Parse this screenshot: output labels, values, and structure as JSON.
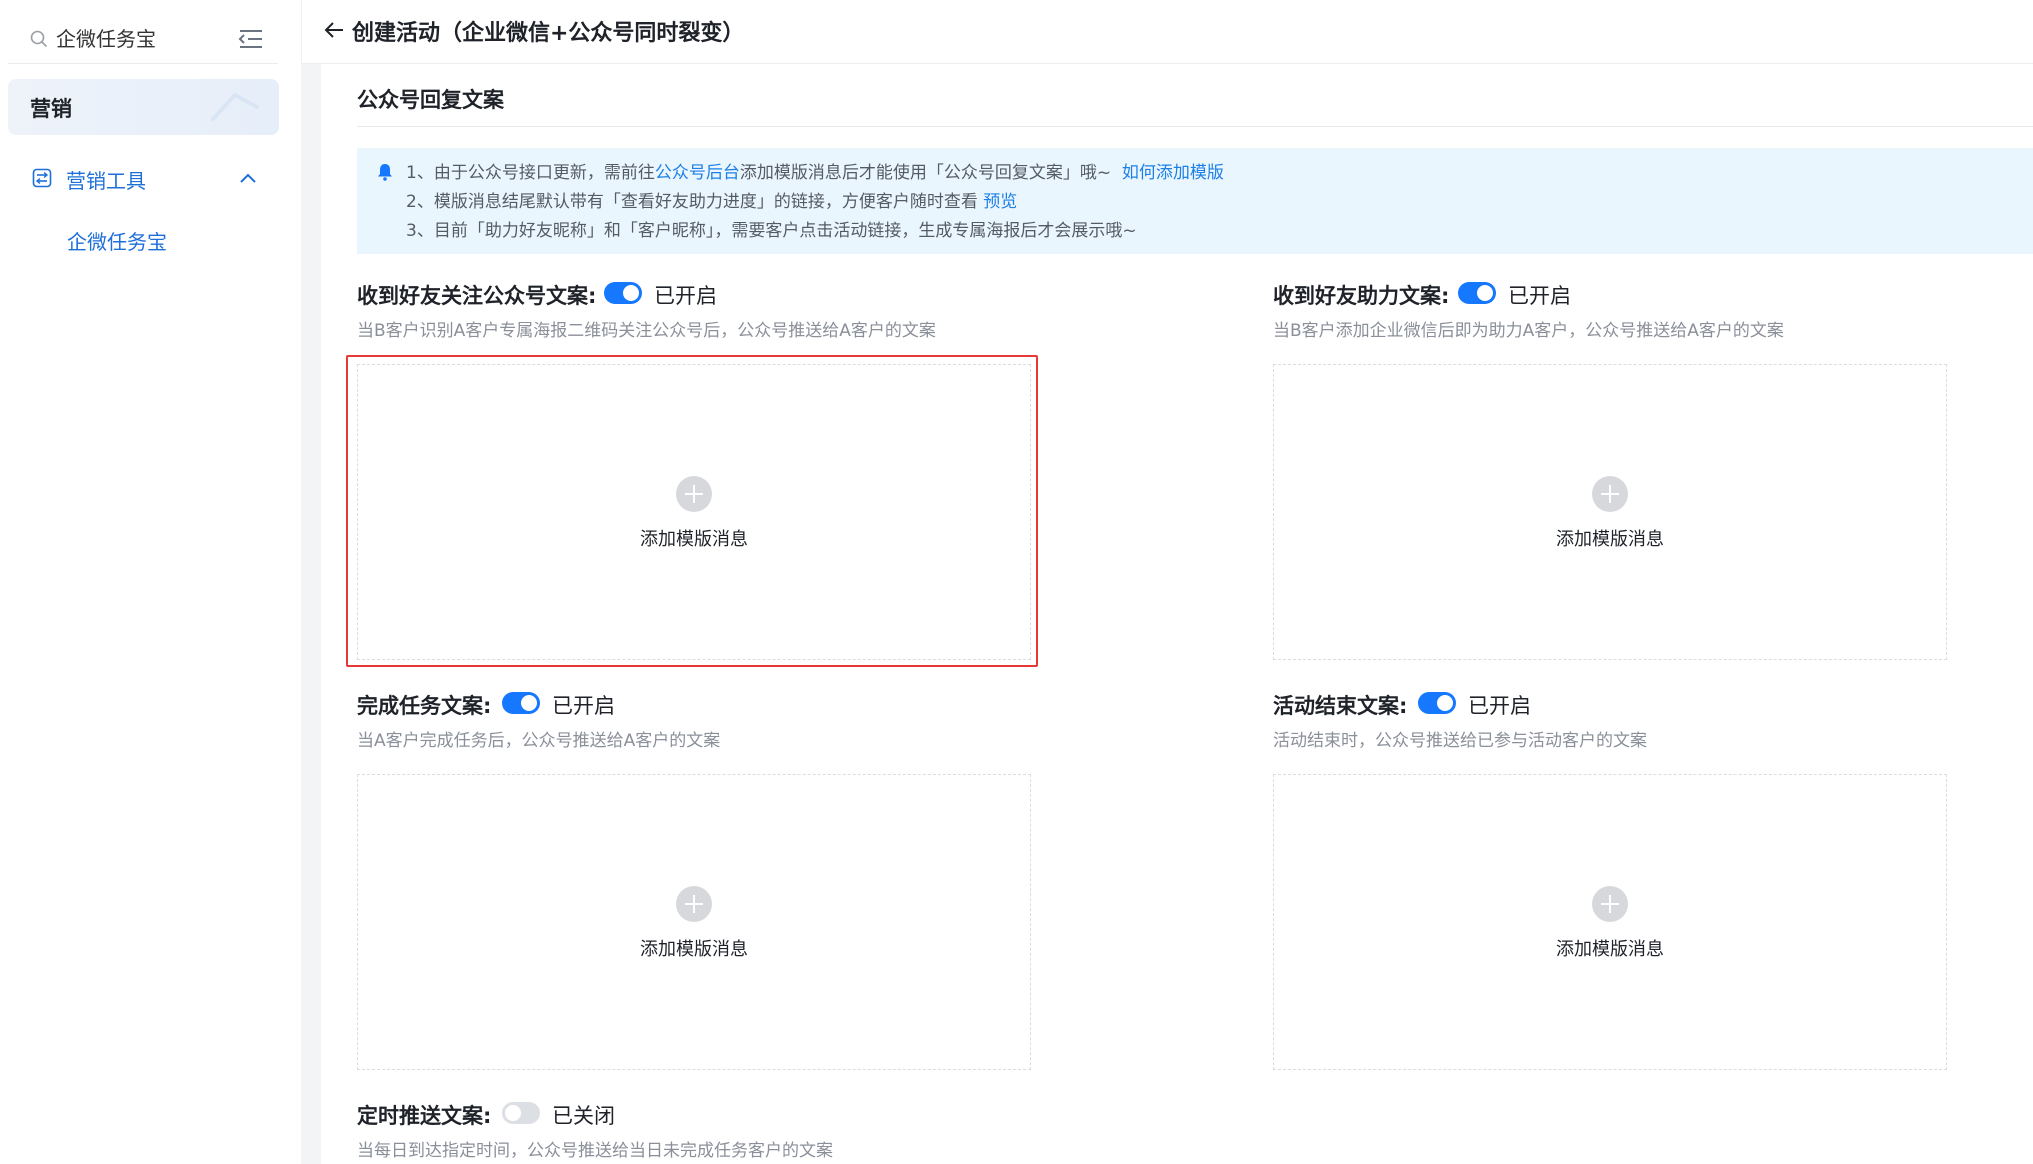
{
  "colors": {
    "accent": "#1677ff",
    "link": "#1e7fe6",
    "highlight": "#e53935",
    "notice_bg": "#eaf6fd"
  },
  "sidebar": {
    "search": {
      "placeholder": "企微任务宝",
      "icon": "search-icon"
    },
    "collapse_icon": "menu-collapse-icon",
    "active_item": "营销",
    "group": {
      "label": "营销工具",
      "icon": "tools-icon",
      "expanded": true
    },
    "sub_item": "企微任务宝"
  },
  "header": {
    "back_icon": "arrow-left-icon",
    "title": "创建活动（企业微信+公众号同时裂变）"
  },
  "section": {
    "title": "公众号回复文案"
  },
  "notice": {
    "icon": "bell-icon",
    "line1_a": "1、由于公众号接口更新，需前往",
    "line1_link": "公众号后台",
    "line1_b": "添加模版消息后才能使用「公众号回复文案」哦~",
    "line1_link2": "如何添加模版",
    "line2_a": "2、模版消息结尾默认带有「查看好友助力进度」的链接，方便客户随时查看",
    "line2_link": "预览",
    "line3": "3、目前「助力好友昵称」和「客户昵称」，需要客户点击活动链接，生成专属海报后才会展示哦~"
  },
  "blocks": [
    {
      "title": "收到好友关注公众号文案:",
      "enabled": true,
      "status": "已开启",
      "desc": "当B客户识别A客户专属海报二维码关注公众号后，公众号推送给A客户的文案",
      "upload_label": "添加模版消息",
      "highlighted": true
    },
    {
      "title": "收到好友助力文案:",
      "enabled": true,
      "status": "已开启",
      "desc": "当B客户添加企业微信后即为助力A客户，公众号推送给A客户的文案",
      "upload_label": "添加模版消息",
      "highlighted": false
    },
    {
      "title": "完成任务文案:",
      "enabled": true,
      "status": "已开启",
      "desc": "当A客户完成任务后，公众号推送给A客户的文案",
      "upload_label": "添加模版消息",
      "highlighted": false
    },
    {
      "title": "活动结束文案:",
      "enabled": true,
      "status": "已开启",
      "desc": "活动结束时，公众号推送给已参与活动客户的文案",
      "upload_label": "添加模版消息",
      "highlighted": false
    },
    {
      "title": "定时推送文案:",
      "enabled": false,
      "status": "已关闭",
      "desc": "当每日到达指定时间，公众号推送给当日未完成任务客户的文案"
    }
  ]
}
